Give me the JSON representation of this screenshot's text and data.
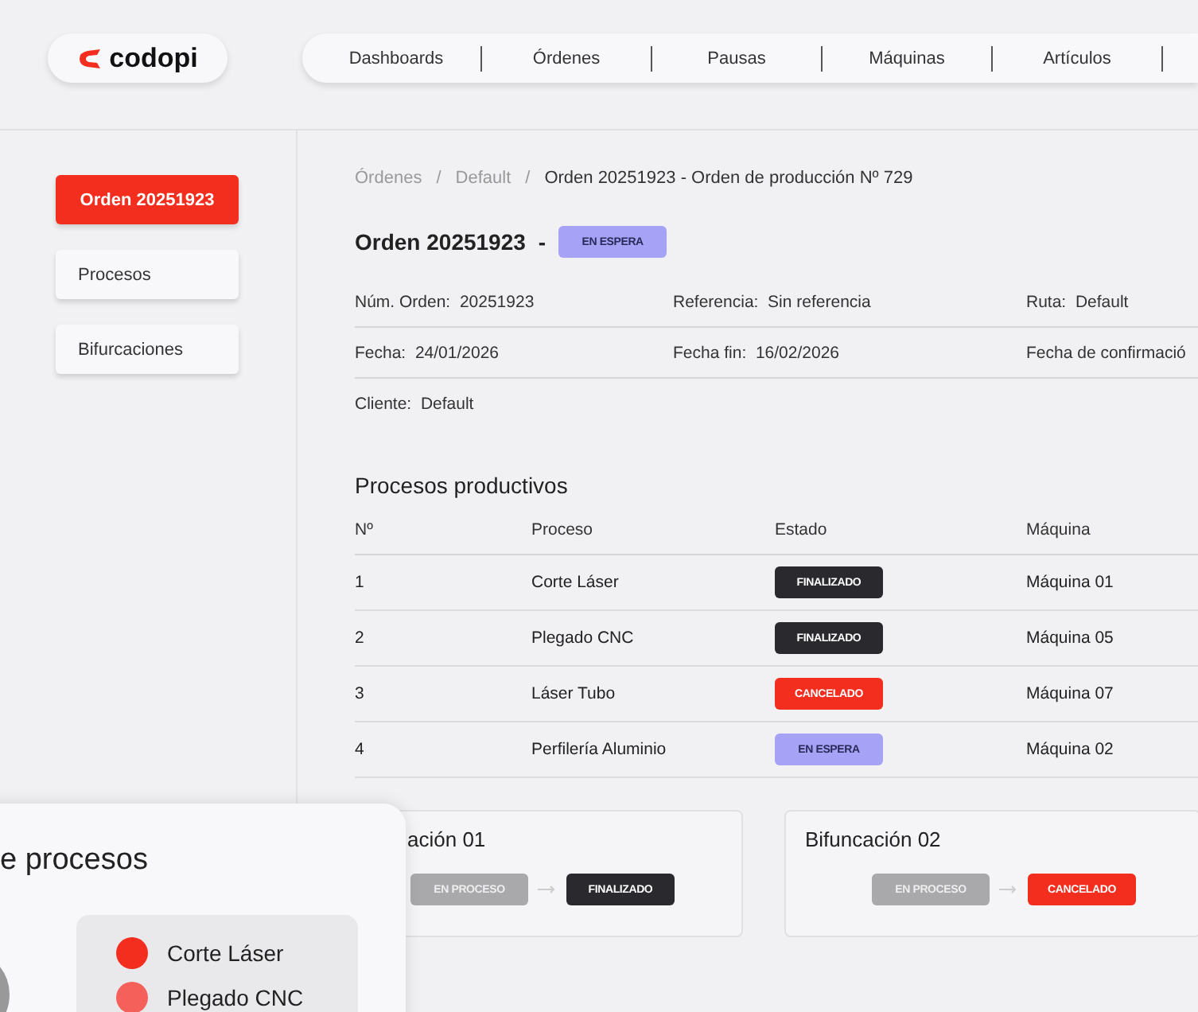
{
  "logo": {
    "text": "codopi"
  },
  "nav": [
    {
      "label": "Dashboards"
    },
    {
      "label": "Órdenes"
    },
    {
      "label": "Pausas"
    },
    {
      "label": "Máquinas"
    },
    {
      "label": "Artículos"
    }
  ],
  "sidebar": {
    "items": [
      {
        "label": "Orden 20251923",
        "selected": true
      },
      {
        "label": "Procesos",
        "selected": false
      },
      {
        "label": "Bifurcaciones",
        "selected": false
      }
    ]
  },
  "breadcrumb": {
    "separator": "/",
    "items": [
      {
        "label": "Órdenes",
        "current": false
      },
      {
        "label": "Default",
        "current": false
      },
      {
        "label": "Orden 20251923  -  Orden de producción Nº 729",
        "current": true
      }
    ]
  },
  "order": {
    "title": "Orden 20251923",
    "separator": "-",
    "status": {
      "label": "EN ESPERA",
      "kind": "waiting"
    }
  },
  "info_rows": [
    [
      {
        "label": "Núm. Orden:",
        "value": "20251923"
      },
      {
        "label": "Referencia:",
        "value": "Sin referencia"
      },
      {
        "label": "Ruta:",
        "value": "Default"
      }
    ],
    [
      {
        "label": "Fecha:",
        "value": "24/01/2026"
      },
      {
        "label": "Fecha fin:",
        "value": "16/02/2026"
      },
      {
        "label": "Fecha de confirmació"
      }
    ],
    [
      {
        "label": "Cliente:",
        "value": "Default"
      }
    ]
  ],
  "processes": {
    "title": "Procesos productivos",
    "columns": [
      "Nº",
      "Proceso",
      "Estado",
      "Máquina"
    ],
    "rows": [
      {
        "n": "1",
        "process": "Corte Láser",
        "status": {
          "label": "FINALIZADO",
          "kind": "done"
        },
        "machine": "Máquina 01"
      },
      {
        "n": "2",
        "process": "Plegado CNC",
        "status": {
          "label": "FINALIZADO",
          "kind": "done"
        },
        "machine": "Máquina 05"
      },
      {
        "n": "3",
        "process": "Láser Tubo",
        "status": {
          "label": "CANCELADO",
          "kind": "cancelled"
        },
        "machine": "Máquina 07"
      },
      {
        "n": "4",
        "process": "Perfilería Aluminio",
        "status": {
          "label": "EN ESPERA",
          "kind": "waiting"
        },
        "machine": "Máquina 02"
      }
    ]
  },
  "bifurcations": [
    {
      "title": "ación 01",
      "steps": [
        {
          "label": "EN PROCESO",
          "kind": "progress"
        },
        {
          "label": "FINALIZADO",
          "kind": "done"
        }
      ]
    },
    {
      "title": "Bifuncación 02",
      "steps": [
        {
          "label": "EN PROCESO",
          "kind": "progress"
        },
        {
          "label": "CANCELADO",
          "kind": "cancelled"
        }
      ]
    }
  ],
  "overlay": {
    "title": "e procesos",
    "legend": [
      {
        "label": "Corte Láser",
        "color": "#f42e1e"
      },
      {
        "label": "Plegado CNC",
        "color": "#f5605a"
      }
    ]
  }
}
